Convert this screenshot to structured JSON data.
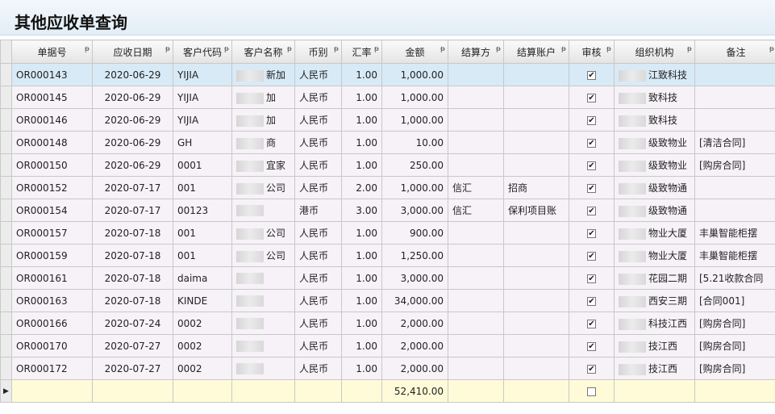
{
  "title": "其他应收单查询",
  "columns": [
    "单据号",
    "应收日期",
    "客户代码",
    "客户名称",
    "币别",
    "汇率",
    "金额",
    "结算方",
    "结算账户",
    "审核",
    "组织机构",
    "备注"
  ],
  "pin_icon": "pin-icon",
  "rows": [
    {
      "no": "OR000143",
      "date": "2020-06-29",
      "code": "YIJIA",
      "name": "新加",
      "cur": "人民币",
      "rate": "1.00",
      "amt": "1,000.00",
      "settle": "",
      "acct": "",
      "audit": "✔",
      "org": "江致科技",
      "note": ""
    },
    {
      "no": "OR000145",
      "date": "2020-06-29",
      "code": "YIJIA",
      "name": "加",
      "cur": "人民币",
      "rate": "1.00",
      "amt": "1,000.00",
      "settle": "",
      "acct": "",
      "audit": "✔",
      "org": "致科技",
      "note": ""
    },
    {
      "no": "OR000146",
      "date": "2020-06-29",
      "code": "YIJIA",
      "name": "加",
      "cur": "人民币",
      "rate": "1.00",
      "amt": "1,000.00",
      "settle": "",
      "acct": "",
      "audit": "✔",
      "org": "致科技",
      "note": ""
    },
    {
      "no": "OR000148",
      "date": "2020-06-29",
      "code": "GH",
      "name": "商",
      "cur": "人民币",
      "rate": "1.00",
      "amt": "10.00",
      "settle": "",
      "acct": "",
      "audit": "✔",
      "org": "级致物业",
      "note": "[清洁合同]"
    },
    {
      "no": "OR000150",
      "date": "2020-06-29",
      "code": "0001",
      "name": "宜家",
      "cur": "人民币",
      "rate": "1.00",
      "amt": "250.00",
      "settle": "",
      "acct": "",
      "audit": "✔",
      "org": "级致物业",
      "note": "[购房合同]"
    },
    {
      "no": "OR000152",
      "date": "2020-07-17",
      "code": "001",
      "name": "公司",
      "cur": "人民币",
      "rate": "2.00",
      "amt": "1,000.00",
      "settle": "信汇",
      "acct": "招商",
      "audit": "✔",
      "org": "级致物通",
      "note": ""
    },
    {
      "no": "OR000154",
      "date": "2020-07-17",
      "code": "00123",
      "name": "",
      "cur": "港币",
      "rate": "3.00",
      "amt": "3,000.00",
      "settle": "信汇",
      "acct": "保利项目账",
      "audit": "✔",
      "org": "级致物通",
      "note": ""
    },
    {
      "no": "OR000157",
      "date": "2020-07-18",
      "code": "001",
      "name": "公司",
      "cur": "人民币",
      "rate": "1.00",
      "amt": "900.00",
      "settle": "",
      "acct": "",
      "audit": "✔",
      "org": "物业大厦",
      "note": "丰巢智能柜摆"
    },
    {
      "no": "OR000159",
      "date": "2020-07-18",
      "code": "001",
      "name": "公司",
      "cur": "人民币",
      "rate": "1.00",
      "amt": "1,250.00",
      "settle": "",
      "acct": "",
      "audit": "✔",
      "org": "物业大厦",
      "note": "丰巢智能柜摆"
    },
    {
      "no": "OR000161",
      "date": "2020-07-18",
      "code": "daima",
      "name": "",
      "cur": "人民币",
      "rate": "1.00",
      "amt": "3,000.00",
      "settle": "",
      "acct": "",
      "audit": "✔",
      "org": "花园二期",
      "note": "[5.21收款合同"
    },
    {
      "no": "OR000163",
      "date": "2020-07-18",
      "code": "KINDE",
      "name": "",
      "cur": "人民币",
      "rate": "1.00",
      "amt": "34,000.00",
      "settle": "",
      "acct": "",
      "audit": "✔",
      "org": "西安三期",
      "note": "[合同001]"
    },
    {
      "no": "OR000166",
      "date": "2020-07-24",
      "code": "0002",
      "name": "",
      "cur": "人民币",
      "rate": "1.00",
      "amt": "2,000.00",
      "settle": "",
      "acct": "",
      "audit": "✔",
      "org": "科技江西",
      "note": "[购房合同]"
    },
    {
      "no": "OR000170",
      "date": "2020-07-27",
      "code": "0002",
      "name": "",
      "cur": "人民币",
      "rate": "1.00",
      "amt": "2,000.00",
      "settle": "",
      "acct": "",
      "audit": "✔",
      "org": "技江西",
      "note": "[购房合同]"
    },
    {
      "no": "OR000172",
      "date": "2020-07-27",
      "code": "0002",
      "name": "",
      "cur": "人民币",
      "rate": "1.00",
      "amt": "2,000.00",
      "settle": "",
      "acct": "",
      "audit": "✔",
      "org": "技江西",
      "note": "[购房合同]"
    }
  ],
  "total": {
    "indicator": "▶",
    "amt": "52,410.00"
  }
}
